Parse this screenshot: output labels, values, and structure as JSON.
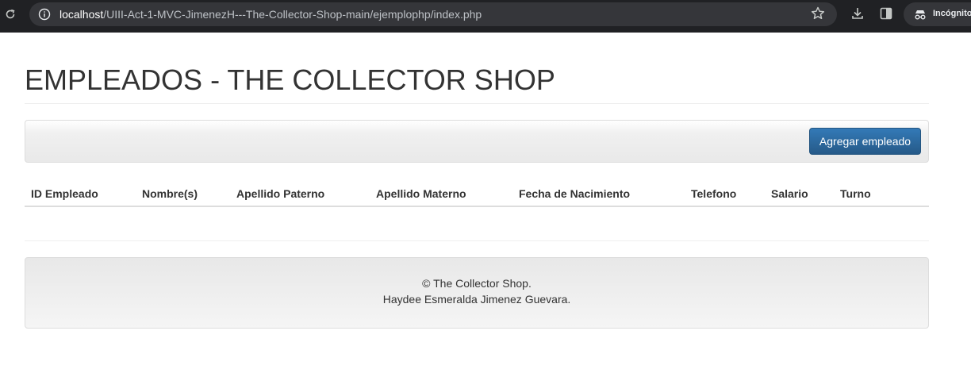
{
  "browser": {
    "url_host": "localhost",
    "url_path": "/UIII-Act-1-MVC-JimenezH---The-Collector-Shop-main/ejemplophp/index.php",
    "incognito_label": "Incógnito",
    "icons": [
      "reload-icon",
      "site-info-icon",
      "star-icon",
      "download-icon",
      "sidepanel-icon",
      "incognito-icon"
    ]
  },
  "page": {
    "title": "EMPLEADOS - THE COLLECTOR SHOP",
    "add_button_label": "Agregar empleado",
    "accent_color": "#337ab7"
  },
  "table": {
    "headers": [
      "ID Empleado",
      "Nombre(s)",
      "Apellido Paterno",
      "Apellido Materno",
      "Fecha de Nacimiento",
      "Telefono",
      "Salario",
      "Turno"
    ],
    "rows": []
  },
  "footer": {
    "line1": "© The Collector Shop.",
    "line2": "Haydee Esmeralda Jimenez Guevara."
  }
}
